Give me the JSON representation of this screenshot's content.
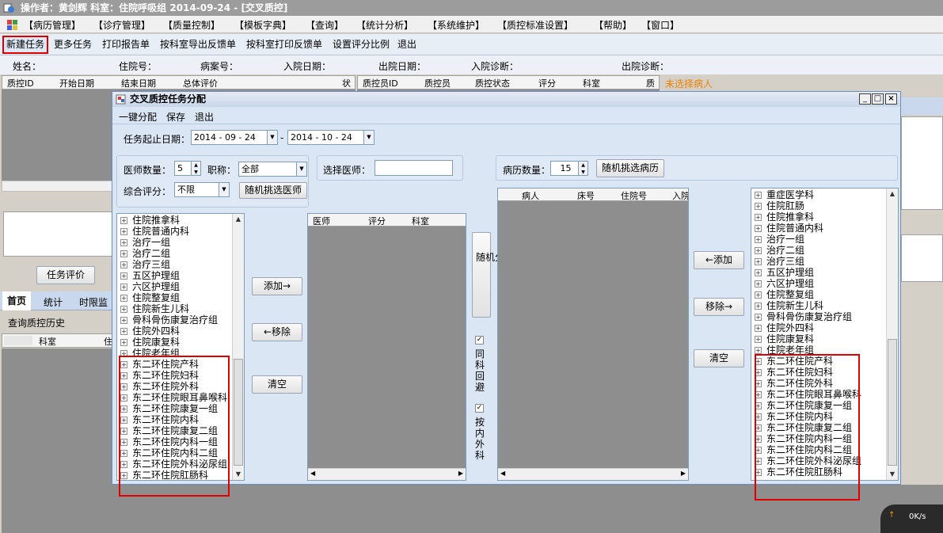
{
  "title": "操作者：黄剑辉   科室：住院呼吸组   2014-09-24 - [交叉质控]",
  "menu": [
    "【病历管理】",
    "【诊疗管理】",
    "【质量控制】",
    "【模板字典】",
    "【查询】",
    "【统计分析】",
    "【系统维护】",
    "【质控标准设置】",
    "【帮助】",
    "【窗口】"
  ],
  "toolbar": [
    "新建任务",
    "更多任务",
    "打印报告单",
    "按科室导出反馈单",
    "按科室打印反馈单",
    "设置评分比例",
    "退出"
  ],
  "info": [
    "姓名：",
    "住院号：",
    "病案号：",
    "入院日期：",
    "出院日期：",
    "入院诊断：",
    "出院诊断："
  ],
  "left_grid_headers": [
    "质控ID",
    "开始日期",
    "结束日期",
    "总体评价",
    "状"
  ],
  "right_grid_headers": [
    "质控员ID",
    "质控员",
    "质控状态",
    "评分",
    "科室",
    "质"
  ],
  "no_patient": "未选择病人",
  "task_eval": "任务评价",
  "tabs": [
    "首页",
    "统计",
    "时限监"
  ],
  "history": "查询质控历史",
  "history_headers": [
    "科室",
    "住"
  ],
  "dialog": {
    "title": "交叉质控任务分配",
    "menu": [
      "一键分配",
      "保存",
      "退出"
    ],
    "date_label": "任务起止日期：",
    "date_start": "2014 - 09 - 24",
    "date_end": "2014 - 10 - 24",
    "doctor_count_label": "医师数量：",
    "doctor_count": "5",
    "title_label": "职称：",
    "title_value": "全部",
    "score_label": "综合评分：",
    "score_value": "不限",
    "random_doctor": "随机挑选医师",
    "select_doctor": "选择医师：",
    "record_count_label": "病历数量：",
    "record_count": "15",
    "random_record": "随机挑选病历",
    "add_right": "添加→",
    "remove_left": "←移除",
    "clear": "清空",
    "add_left": "←添加",
    "remove_right": "移除→",
    "random_assign": "随机分配",
    "same_dept_avoid": "同科回避",
    "by_internal_surgery": "按内外科",
    "doctor_list_headers": [
      "医师",
      "评分",
      "科室"
    ],
    "patient_list_headers": [
      "病人",
      "床号",
      "住院号",
      "入院"
    ],
    "left_tree": [
      "住院推拿科",
      "住院普通内科",
      "治疗一组",
      "治疗二组",
      "治疗三组",
      "五区护理组",
      "六区护理组",
      "住院整复组",
      "住院新生儿科",
      "骨科骨伤康复治疗组",
      "住院外四科",
      "住院康复科",
      "住院老年组",
      "东二环住院产科",
      "东二环住院妇科",
      "东二环住院外科",
      "东二环住院眼耳鼻喉科",
      "东二环住院康复一组",
      "东二环住院内科",
      "东二环住院康复二组",
      "东二环住院内科一组",
      "东二环住院内科二组",
      "东二环住院外科泌尿组",
      "东二环住院肛肠科"
    ],
    "right_tree": [
      "重症医学科",
      "住院肛肠",
      "住院推拿科",
      "住院普通内科",
      "治疗一组",
      "治疗二组",
      "治疗三组",
      "五区护理组",
      "六区护理组",
      "住院整复组",
      "住院新生儿科",
      "骨科骨伤康复治疗组",
      "住院外四科",
      "住院康复科",
      "住院老年组",
      "东二环住院产科",
      "东二环住院妇科",
      "东二环住院外科",
      "东二环住院眼耳鼻喉科",
      "东二环住院康复一组",
      "东二环住院内科",
      "东二环住院康复二组",
      "东二环住院内科一组",
      "东二环住院内科二组",
      "东二环住院外科泌尿组",
      "东二环住院肛肠科"
    ]
  },
  "net_speed": "0K/s",
  "colors": {
    "highlight_red": "#e00000",
    "title_gray": "#9c9c9c",
    "dialog_bg": "#dbe6f4",
    "orange_text": "#f08000"
  }
}
